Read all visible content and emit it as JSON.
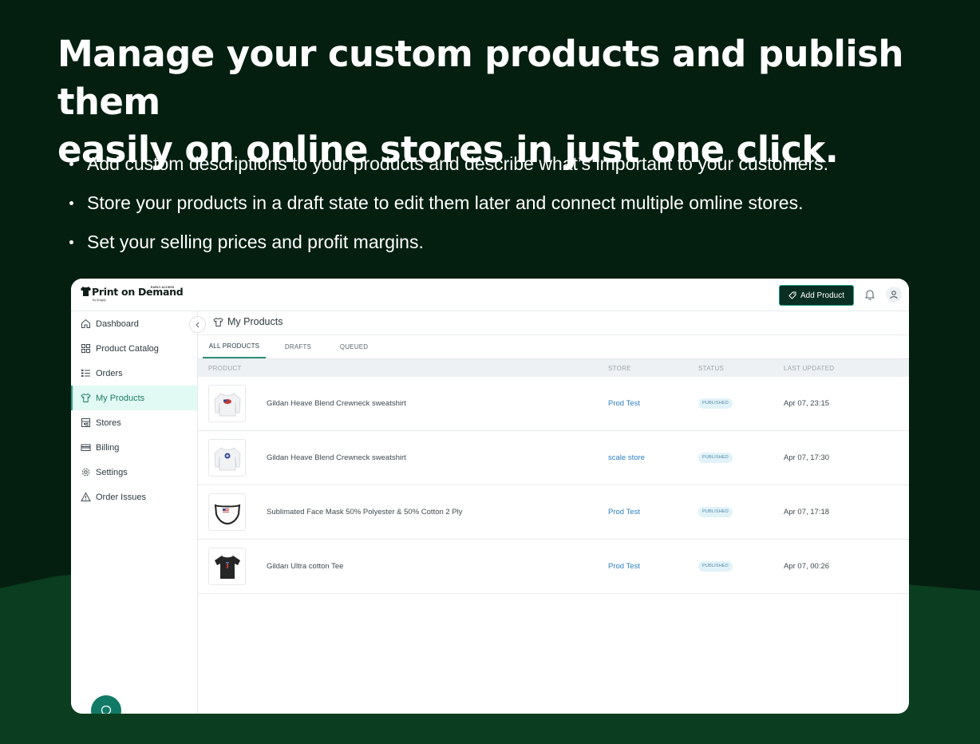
{
  "hero": {
    "title_line1": "Manage your custom products and publish them",
    "title_line2": "easily on online stores in just one click.",
    "bullets": [
      "Add custom descriptions to your products and describe what’s important to your customers.",
      "Store your products in a draft state to edit them later and connect multiple omline stores.",
      "Set your selling prices and profit margins."
    ]
  },
  "app": {
    "brand": {
      "name": "Print on Demand",
      "badge": "EARLY ACCESS",
      "by": "By Snagify"
    },
    "header": {
      "add_product_label": "Add Product"
    },
    "sidebar": {
      "items": [
        {
          "label": "Dashboard",
          "icon": "home-icon"
        },
        {
          "label": "Product Catalog",
          "icon": "grid-icon"
        },
        {
          "label": "Orders",
          "icon": "list-icon"
        },
        {
          "label": "My Products",
          "icon": "tshirt-icon",
          "active": true
        },
        {
          "label": "Stores",
          "icon": "store-icon"
        },
        {
          "label": "Billing",
          "icon": "card-icon"
        },
        {
          "label": "Settings",
          "icon": "gear-icon"
        },
        {
          "label": "Order Issues",
          "icon": "warning-icon"
        }
      ]
    },
    "main": {
      "page_title": "My Products",
      "tabs": [
        {
          "label": "ALL PRODUCTS",
          "active": true
        },
        {
          "label": "DRAFTS"
        },
        {
          "label": "QUEUED"
        }
      ],
      "columns": {
        "product": "PRODUCT",
        "store": "STORE",
        "status": "STATUS",
        "updated": "LAST UPDATED"
      },
      "rows": [
        {
          "product": "Gildan Heave Blend Crewneck sweatshirt",
          "store": "Prod Test",
          "status": "PUBLISHED",
          "updated": "Apr 07, 23:15",
          "thumb": "sweatshirt-flag"
        },
        {
          "product": "Gildan Heave Blend Crewneck sweatshirt",
          "store": "scale store",
          "status": "PUBLISHED",
          "updated": "Apr 07, 17:30",
          "thumb": "sweatshirt-globe"
        },
        {
          "product": "Sublimated Face Mask 50% Polyester & 50% Cotton 2 Ply",
          "store": "Prod Test",
          "status": "PUBLISHED",
          "updated": "Apr 07, 17:18",
          "thumb": "face-mask"
        },
        {
          "product": "Gildan Ultra cotton Tee",
          "store": "Prod Test",
          "status": "PUBLISHED",
          "updated": "Apr 07, 00:26",
          "thumb": "black-tee"
        }
      ]
    }
  },
  "colors": {
    "background": "#041f10",
    "hill": "#0b3d20",
    "accent": "#117a66",
    "link": "#2c7fc4"
  }
}
